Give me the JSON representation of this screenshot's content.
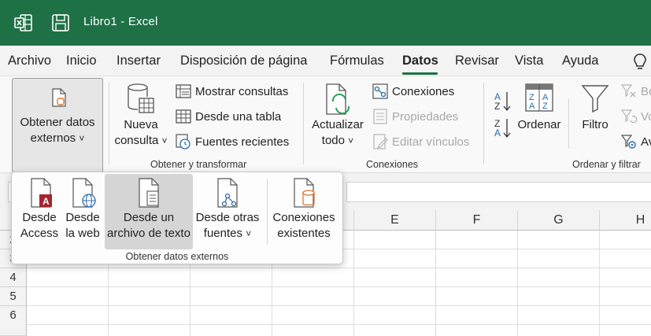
{
  "titlebar": {
    "title": "Libro1  -  Excel",
    "app_icon": "excel-icon",
    "save_icon": "save-icon",
    "color": "#1e7145"
  },
  "tabs": [
    {
      "label": "Archivo"
    },
    {
      "label": "Inicio"
    },
    {
      "label": "Insertar"
    },
    {
      "label": "Disposición de página"
    },
    {
      "label": "Fórmulas"
    },
    {
      "label": "Datos",
      "active": true
    },
    {
      "label": "Revisar"
    },
    {
      "label": "Vista"
    },
    {
      "label": "Ayuda"
    }
  ],
  "ribbon": {
    "obtener": {
      "line1": "Obtener datos",
      "line2": "externos",
      "caret": "˅"
    },
    "obtener_transformar": {
      "nueva_line1": "Nueva",
      "nueva_line2": "consulta",
      "caret": "˅",
      "mostrar": "Mostrar consultas",
      "desde_tabla": "Desde una tabla",
      "fuentes": "Fuentes recientes",
      "label": "Obtener y transformar"
    },
    "conexiones": {
      "actualizar_line1": "Actualizar",
      "actualizar_line2": "todo",
      "caret": "˅",
      "conexiones": "Conexiones",
      "propiedades": "Propiedades",
      "editar": "Editar vínculos",
      "label": "Conexiones"
    },
    "ordenar_filtrar": {
      "ordenar": "Ordenar",
      "filtro": "Filtro",
      "borrar": "Bo",
      "volver": "Vo",
      "avanzadas": "Av",
      "label": "Ordenar y filtrar"
    }
  },
  "dropdown": {
    "items": [
      {
        "line1": "Desde",
        "line2": "Access",
        "icon": "access-file-icon"
      },
      {
        "line1": "Desde",
        "line2": "la web",
        "icon": "web-file-icon"
      },
      {
        "line1": "Desde un",
        "line2": "archivo de texto",
        "icon": "text-file-icon",
        "hover": true
      },
      {
        "line1": "Desde otras",
        "line2": "fuentes",
        "icon": "other-sources-icon",
        "caret": "˅"
      },
      {
        "line1": "Conexiones",
        "line2": "existentes",
        "icon": "existing-connections-icon"
      }
    ],
    "label": "Obtener datos externos"
  },
  "sheet": {
    "columns": [
      "E",
      "F",
      "G",
      "H"
    ],
    "rows": [
      "2",
      "3",
      "4",
      "5",
      "6"
    ]
  }
}
